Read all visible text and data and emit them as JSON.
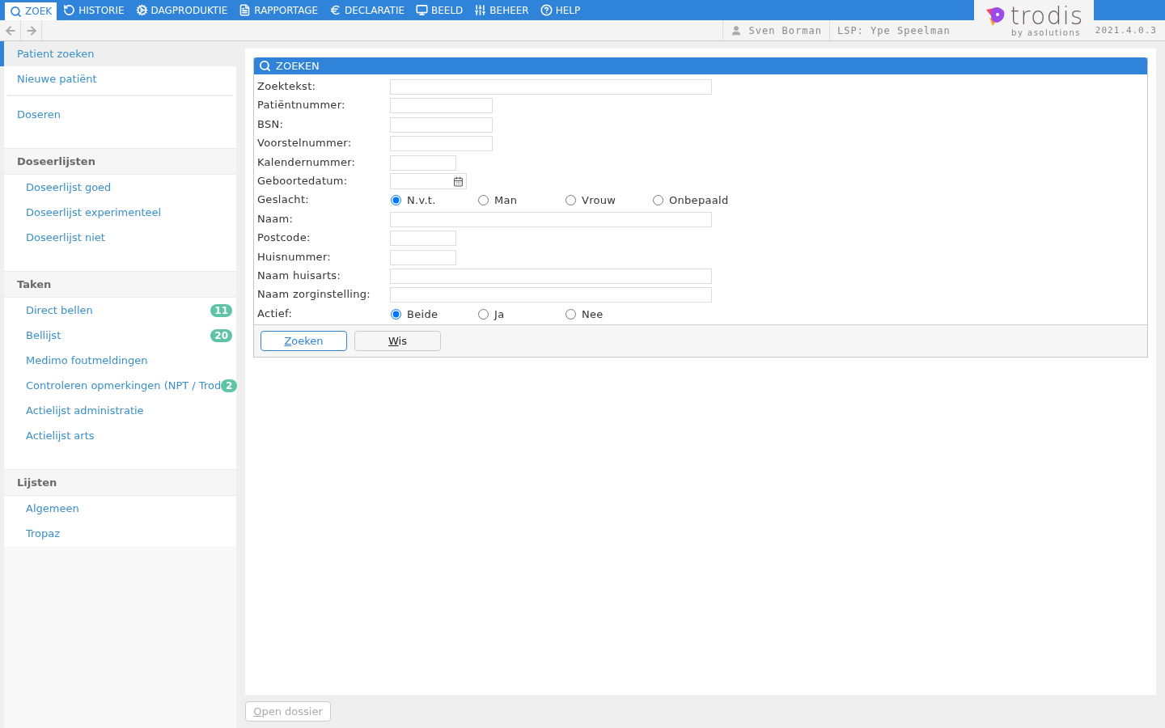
{
  "menu": [
    {
      "label": "ZOEK",
      "selected": true
    },
    {
      "label": "HISTORIE",
      "selected": false
    },
    {
      "label": "DAGPRODUKTIE",
      "selected": false
    },
    {
      "label": "RAPPORTAGE",
      "selected": false
    },
    {
      "label": "DECLARATIE",
      "selected": false
    },
    {
      "label": "BEELD",
      "selected": false
    },
    {
      "label": "BEHEER",
      "selected": false
    },
    {
      "label": "HELP",
      "selected": false
    }
  ],
  "logo": {
    "name": "trodis",
    "tagline_prefix": "by ",
    "tagline_brand": "asolutions"
  },
  "user": "Sven Borman",
  "lsp": "LSP: Ype Speelman",
  "version": "2021.4.0.3",
  "sidebar": {
    "top_items": [
      {
        "label": "Patient zoeken",
        "selected": true
      },
      {
        "label": "Nieuwe patiënt",
        "selected": false
      },
      {
        "label": "Doseren",
        "selected": false
      }
    ],
    "sections": [
      {
        "title": "Doseerlijsten",
        "items": [
          {
            "label": "Doseerlijst goed"
          },
          {
            "label": "Doseerlijst experimenteel"
          },
          {
            "label": "Doseerlijst niet"
          }
        ]
      },
      {
        "title": "Taken",
        "items": [
          {
            "label": "Direct bellen",
            "badge": "11"
          },
          {
            "label": "Bellijst",
            "badge": "20"
          },
          {
            "label": "Medimo foutmeldingen"
          },
          {
            "label": "Controleren opmerkingen (NPT / Trod",
            "badge": "2"
          },
          {
            "label": "Actielijst administratie"
          },
          {
            "label": "Actielijst arts"
          }
        ]
      },
      {
        "title": "Lijsten",
        "items": [
          {
            "label": "Algemeen"
          },
          {
            "label": "Tropaz"
          }
        ]
      }
    ]
  },
  "search_panel": {
    "title": "ZOEKEN",
    "fields": [
      {
        "label": "Zoektekst:",
        "kind": "wide"
      },
      {
        "label": "Patiëntnummer:",
        "kind": "medium"
      },
      {
        "label": "BSN:",
        "kind": "medium"
      },
      {
        "label": "Voorstelnummer:",
        "kind": "medium"
      },
      {
        "label": "Kalendernummer:",
        "kind": "short"
      },
      {
        "label": "Geboortedatum:",
        "kind": "date"
      },
      {
        "label": "Geslacht:",
        "kind": "radio",
        "options": [
          {
            "label": "N.v.t.",
            "selected": true
          },
          {
            "label": "Man",
            "selected": false
          },
          {
            "label": "Vrouw",
            "selected": false
          },
          {
            "label": "Onbepaald",
            "selected": false
          }
        ]
      },
      {
        "label": "Naam:",
        "kind": "wide"
      },
      {
        "label": "Postcode:",
        "kind": "short"
      },
      {
        "label": "Huisnummer:",
        "kind": "short"
      },
      {
        "label": "Naam huisarts:",
        "kind": "wide"
      },
      {
        "label": "Naam zorginstelling:",
        "kind": "wide"
      },
      {
        "label": "Actief:",
        "kind": "radio",
        "options": [
          {
            "label": "Beide",
            "selected": true
          },
          {
            "label": "Ja",
            "selected": false
          },
          {
            "label": "Nee",
            "selected": false
          }
        ]
      }
    ],
    "buttons": [
      {
        "label": "Zoeken",
        "primary": true
      },
      {
        "label": "Wis",
        "primary": false
      }
    ]
  },
  "footer_button": {
    "label": "Open dossier",
    "disabled": true
  }
}
